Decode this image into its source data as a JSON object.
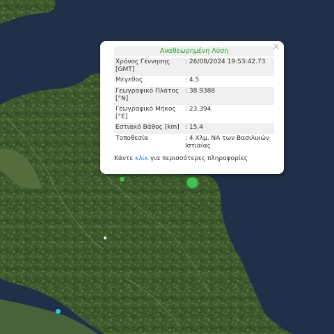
{
  "popup": {
    "title": "Αναθεωρημένη Λύση",
    "close_symbol": "×",
    "rows": [
      {
        "label": "Χρόνος Γέννησης [GMT]",
        "value": ": 26/08/2024 19:53:42.73"
      },
      {
        "label": "Μέγεθος",
        "value": ": 4.5"
      },
      {
        "label": "Γεωγραφικό Πλάτος [°N]",
        "value": ": 38.9388"
      },
      {
        "label": "Γεωγραφικό Μήκος [°E]",
        "value": ": 23.394"
      },
      {
        "label": "Εστιακό Βάθος [km]",
        "value": ": 15.4"
      },
      {
        "label": "Τοποθεσία",
        "value": ": 4 Χλμ. ΝΑ των Βασιλικών Ιστιαίας"
      }
    ],
    "more_prefix": "Κάντε ",
    "more_link": "κλικ",
    "more_suffix": " για περισσότερες πληροφορίες"
  },
  "markers": {
    "main_color": "#3fc453",
    "other_colors": [
      "#3fc453",
      "#35c6e0",
      "#ffffff"
    ]
  },
  "colors": {
    "sea": "#1f3048",
    "land": "#3d5a2e",
    "title_green": "#28a028",
    "link_blue": "#2a6fd0"
  }
}
